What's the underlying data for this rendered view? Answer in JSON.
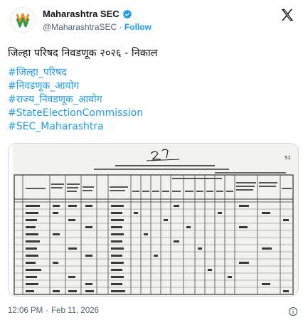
{
  "account": {
    "display_name": "Maharashtra SEC",
    "handle": "@MaharashtraSEC",
    "separator": "·",
    "follow_label": "Follow"
  },
  "post": {
    "title": "जिल्हा परिषद निवडणूक २०२६ - निकाल",
    "hashtags": [
      "#जिल्हा_परिषद",
      "#निवडणूक_आयोग",
      "#राज्य_निवडणूक_आयोग",
      "#StateElectionCommission",
      "#SEC_Maharashtra"
    ]
  },
  "footer": {
    "time": "12:06 PM",
    "separator": "·",
    "date": "Feb 11, 2026"
  },
  "icons": {
    "verified": "verified-badge-icon",
    "platform": "x-logo-icon",
    "info": "info-icon"
  },
  "colors": {
    "accent": "#1d9bf0",
    "secondary_text": "#536471",
    "primary_text": "#0f1419"
  }
}
